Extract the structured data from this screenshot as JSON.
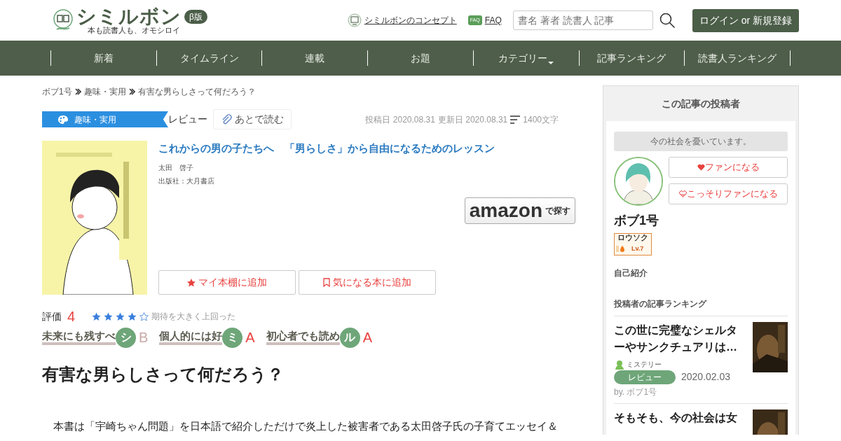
{
  "header": {
    "logo_title": "シミルボン",
    "logo_badge": "β版",
    "tagline": "本も読書人も、オモシロイ",
    "links": [
      {
        "label": "シミルボンのコンセプト",
        "kind": "concept"
      },
      {
        "label": "FAQ",
        "kind": "faq",
        "icon_text": "FAQ"
      }
    ],
    "search": {
      "placeholder": "書名 著者 読書人 記事"
    },
    "login_button": "ログイン or 新規登録"
  },
  "nav": [
    {
      "label": "新着",
      "dropdown": false
    },
    {
      "label": "タイムライン",
      "dropdown": false
    },
    {
      "label": "連載",
      "dropdown": false
    },
    {
      "label": "お題",
      "dropdown": false
    },
    {
      "label": "カテゴリー",
      "dropdown": true
    },
    {
      "label": "記事ランキング",
      "dropdown": false
    },
    {
      "label": "読書人ランキング",
      "dropdown": false
    }
  ],
  "breadcrumb": [
    "ボブ1号",
    "趣味・実用",
    "有害な男らしさって何だろう？"
  ],
  "article": {
    "category": "趣味・実用",
    "type": "レビュー",
    "read_later": "あとで読む",
    "posted": "投稿日 2020.08.31",
    "updated": "更新日 2020.08.31",
    "length": "1400文字",
    "book": {
      "title": "これからの男の子たちへ　「男らしさ」から自由になるためのレッスン",
      "author": "太田　啓子",
      "publisher": "出版社：大月書店",
      "amazon": "amazon",
      "amazon_suffix": "で探す",
      "buttons": [
        {
          "label": "マイ本棚に追加",
          "kind": "star"
        },
        {
          "label": "気になる本に追加",
          "kind": "bookmark"
        }
      ]
    },
    "rating_label": "評価",
    "rating": "4",
    "stars": 4,
    "rating_comment": "期待を大きく上回った",
    "criteria": [
      {
        "label": "未来にも残すべ",
        "mark": "シ",
        "grade": "B",
        "color": "#c9a9a6"
      },
      {
        "label": "個人的には好",
        "mark": "ミ",
        "grade": "A",
        "color": "#e8423f"
      },
      {
        "label": "初心者でも読め",
        "mark": "ル",
        "grade": "A",
        "color": "#e8423f"
      }
    ],
    "heading": "有害な男らしさって何だろう？",
    "body": "本書は「宇崎ちゃん問題」を日本語で紹介しただけで炎上した被害者である太田啓子氏の子育てエッセイ＆"
  },
  "sidebar": {
    "title": "この記事の投稿者",
    "bubble": "今の社会を憂いています。",
    "buttons": [
      {
        "label": "ファンになる",
        "kind": "heart"
      },
      {
        "label": "こっそりファンになる",
        "kind": "heart-outline"
      }
    ],
    "name": "ボブ1号",
    "badge": {
      "title": "ロウソク",
      "level": "Lv.7"
    },
    "intro_label": "自己紹介",
    "ranking_label": "投稿者の記事ランキング",
    "ranking": [
      {
        "title": "この世に完璧なシェルターやサンクチュアリは…",
        "category": "ミステリー",
        "type": "レビュー",
        "date": "2020.02.03",
        "by": "by. ボブ1号"
      },
      {
        "title": "そもそも、今の社会は女"
      }
    ]
  }
}
